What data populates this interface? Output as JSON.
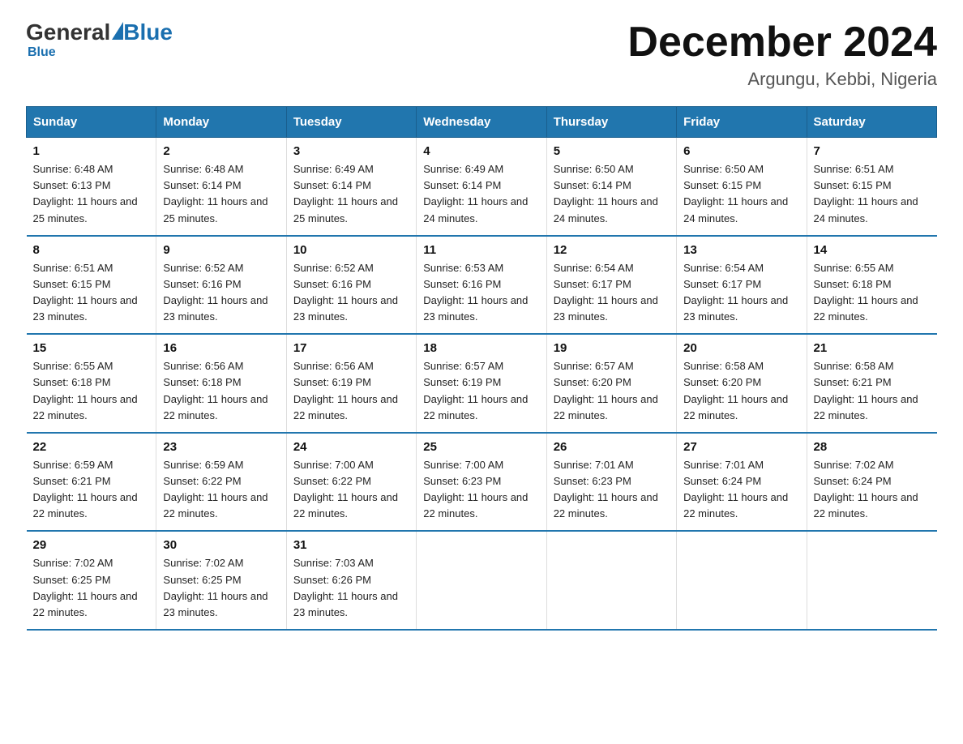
{
  "logo": {
    "general": "General",
    "blue": "Blue"
  },
  "header": {
    "month": "December 2024",
    "location": "Argungu, Kebbi, Nigeria"
  },
  "days_of_week": [
    "Sunday",
    "Monday",
    "Tuesday",
    "Wednesday",
    "Thursday",
    "Friday",
    "Saturday"
  ],
  "weeks": [
    [
      {
        "num": "1",
        "sunrise": "6:48 AM",
        "sunset": "6:13 PM",
        "daylight": "11 hours and 25 minutes."
      },
      {
        "num": "2",
        "sunrise": "6:48 AM",
        "sunset": "6:14 PM",
        "daylight": "11 hours and 25 minutes."
      },
      {
        "num": "3",
        "sunrise": "6:49 AM",
        "sunset": "6:14 PM",
        "daylight": "11 hours and 25 minutes."
      },
      {
        "num": "4",
        "sunrise": "6:49 AM",
        "sunset": "6:14 PM",
        "daylight": "11 hours and 24 minutes."
      },
      {
        "num": "5",
        "sunrise": "6:50 AM",
        "sunset": "6:14 PM",
        "daylight": "11 hours and 24 minutes."
      },
      {
        "num": "6",
        "sunrise": "6:50 AM",
        "sunset": "6:15 PM",
        "daylight": "11 hours and 24 minutes."
      },
      {
        "num": "7",
        "sunrise": "6:51 AM",
        "sunset": "6:15 PM",
        "daylight": "11 hours and 24 minutes."
      }
    ],
    [
      {
        "num": "8",
        "sunrise": "6:51 AM",
        "sunset": "6:15 PM",
        "daylight": "11 hours and 23 minutes."
      },
      {
        "num": "9",
        "sunrise": "6:52 AM",
        "sunset": "6:16 PM",
        "daylight": "11 hours and 23 minutes."
      },
      {
        "num": "10",
        "sunrise": "6:52 AM",
        "sunset": "6:16 PM",
        "daylight": "11 hours and 23 minutes."
      },
      {
        "num": "11",
        "sunrise": "6:53 AM",
        "sunset": "6:16 PM",
        "daylight": "11 hours and 23 minutes."
      },
      {
        "num": "12",
        "sunrise": "6:54 AM",
        "sunset": "6:17 PM",
        "daylight": "11 hours and 23 minutes."
      },
      {
        "num": "13",
        "sunrise": "6:54 AM",
        "sunset": "6:17 PM",
        "daylight": "11 hours and 23 minutes."
      },
      {
        "num": "14",
        "sunrise": "6:55 AM",
        "sunset": "6:18 PM",
        "daylight": "11 hours and 22 minutes."
      }
    ],
    [
      {
        "num": "15",
        "sunrise": "6:55 AM",
        "sunset": "6:18 PM",
        "daylight": "11 hours and 22 minutes."
      },
      {
        "num": "16",
        "sunrise": "6:56 AM",
        "sunset": "6:18 PM",
        "daylight": "11 hours and 22 minutes."
      },
      {
        "num": "17",
        "sunrise": "6:56 AM",
        "sunset": "6:19 PM",
        "daylight": "11 hours and 22 minutes."
      },
      {
        "num": "18",
        "sunrise": "6:57 AM",
        "sunset": "6:19 PM",
        "daylight": "11 hours and 22 minutes."
      },
      {
        "num": "19",
        "sunrise": "6:57 AM",
        "sunset": "6:20 PM",
        "daylight": "11 hours and 22 minutes."
      },
      {
        "num": "20",
        "sunrise": "6:58 AM",
        "sunset": "6:20 PM",
        "daylight": "11 hours and 22 minutes."
      },
      {
        "num": "21",
        "sunrise": "6:58 AM",
        "sunset": "6:21 PM",
        "daylight": "11 hours and 22 minutes."
      }
    ],
    [
      {
        "num": "22",
        "sunrise": "6:59 AM",
        "sunset": "6:21 PM",
        "daylight": "11 hours and 22 minutes."
      },
      {
        "num": "23",
        "sunrise": "6:59 AM",
        "sunset": "6:22 PM",
        "daylight": "11 hours and 22 minutes."
      },
      {
        "num": "24",
        "sunrise": "7:00 AM",
        "sunset": "6:22 PM",
        "daylight": "11 hours and 22 minutes."
      },
      {
        "num": "25",
        "sunrise": "7:00 AM",
        "sunset": "6:23 PM",
        "daylight": "11 hours and 22 minutes."
      },
      {
        "num": "26",
        "sunrise": "7:01 AM",
        "sunset": "6:23 PM",
        "daylight": "11 hours and 22 minutes."
      },
      {
        "num": "27",
        "sunrise": "7:01 AM",
        "sunset": "6:24 PM",
        "daylight": "11 hours and 22 minutes."
      },
      {
        "num": "28",
        "sunrise": "7:02 AM",
        "sunset": "6:24 PM",
        "daylight": "11 hours and 22 minutes."
      }
    ],
    [
      {
        "num": "29",
        "sunrise": "7:02 AM",
        "sunset": "6:25 PM",
        "daylight": "11 hours and 22 minutes."
      },
      {
        "num": "30",
        "sunrise": "7:02 AM",
        "sunset": "6:25 PM",
        "daylight": "11 hours and 23 minutes."
      },
      {
        "num": "31",
        "sunrise": "7:03 AM",
        "sunset": "6:26 PM",
        "daylight": "11 hours and 23 minutes."
      },
      null,
      null,
      null,
      null
    ]
  ]
}
